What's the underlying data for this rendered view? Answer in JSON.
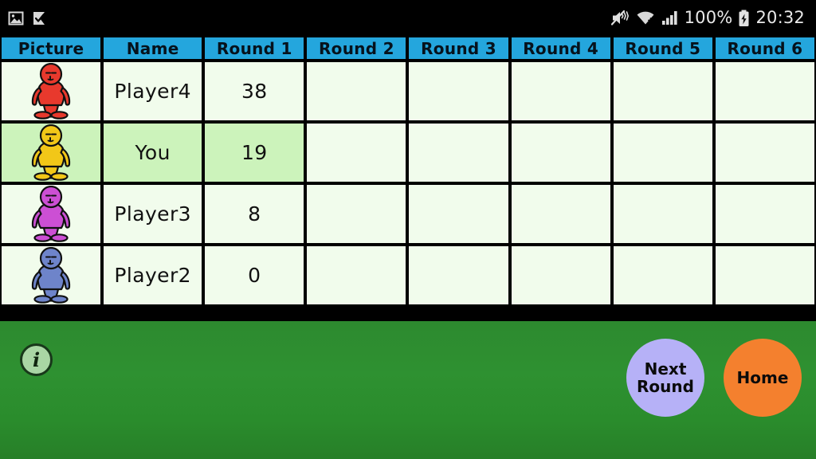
{
  "status_bar": {
    "left_icons": [
      {
        "name": "image-notification-icon",
        "glyph": "image"
      },
      {
        "name": "check-flag-notification-icon",
        "glyph": "flag-check"
      }
    ],
    "right_icons": [
      {
        "name": "volume-mute-icon",
        "glyph": "mute"
      },
      {
        "name": "wifi-icon",
        "glyph": "wifi"
      },
      {
        "name": "cellular-signal-icon",
        "glyph": "signal"
      },
      {
        "name": "battery-charging-icon",
        "glyph": "battery"
      }
    ],
    "battery_percent": "100%",
    "clock": "20:32"
  },
  "table": {
    "columns": [
      "Picture",
      "Name",
      "Round 1",
      "Round 2",
      "Round 3",
      "Round 4",
      "Round 5",
      "Round 6"
    ],
    "rows": [
      {
        "avatar_color": "#e8392d",
        "avatar_name": "player-avatar-red",
        "name": "Player4",
        "scores": [
          "38",
          "",
          "",
          "",
          "",
          ""
        ],
        "highlighted": false
      },
      {
        "avatar_color": "#f2c718",
        "avatar_name": "player-avatar-yellow",
        "name": "You",
        "scores": [
          "19",
          "",
          "",
          "",
          "",
          ""
        ],
        "highlighted": true
      },
      {
        "avatar_color": "#cc4fd4",
        "avatar_name": "player-avatar-purple",
        "name": "Player3",
        "scores": [
          "8",
          "",
          "",
          "",
          "",
          ""
        ],
        "highlighted": false
      },
      {
        "avatar_color": "#6e84ca",
        "avatar_name": "player-avatar-blue",
        "name": "Player2",
        "scores": [
          "0",
          "",
          "",
          "",
          "",
          ""
        ],
        "highlighted": false
      }
    ]
  },
  "bottom_bar": {
    "info_label": "i",
    "next_round_line1": "Next",
    "next_round_line2": "Round",
    "home_label": "Home"
  },
  "colors": {
    "header_blue": "#24a6dd",
    "cell_bg": "#f1fcec",
    "highlight_bg": "#ccf3bb",
    "panel_green": "#2e9131",
    "next_round_btn": "#b6b1f7",
    "home_btn": "#f4802e",
    "info_btn": "#a9d6a4"
  }
}
